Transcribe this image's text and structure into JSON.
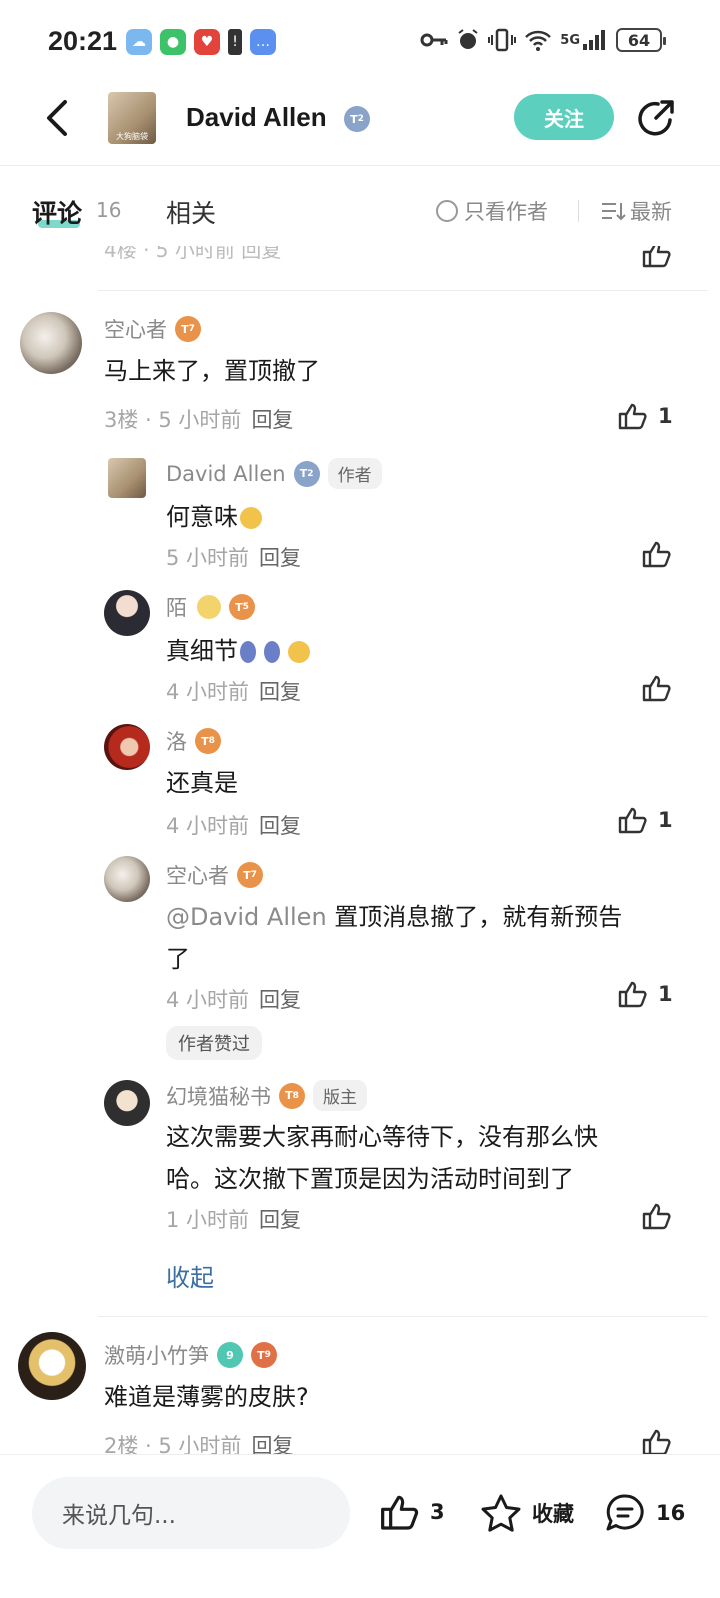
{
  "status_bar": {
    "time": "20:21",
    "network": "5G",
    "battery": "64",
    "icons": [
      "weather-icon",
      "wechat-icon",
      "heart-app-icon",
      "battery-saver-icon",
      "message-icon",
      "key-icon",
      "alarm-icon",
      "vibrate-icon",
      "wifi-icon",
      "signal-icon"
    ]
  },
  "header": {
    "avatar_caption": "大狗脑袋",
    "title": "David Allen",
    "level_badge": "2",
    "follow_label": "关注"
  },
  "tabs": {
    "comments_label": "评论",
    "comments_count": "16",
    "related_label": "相关",
    "only_author_label": "只看作者",
    "sort_label": "最新"
  },
  "partial_row": {
    "text": "4楼 · 5 小时前  回复"
  },
  "comments": [
    {
      "user": "空心者",
      "level": "7",
      "text": "马上来了，置顶撤了",
      "meta": "3楼 · 5 小时前",
      "reply": "回复",
      "likes": "1"
    },
    {
      "user": "David Allen",
      "level": "2",
      "tag": "作者",
      "text": "何意味",
      "meta": "5 小时前",
      "reply": "回复",
      "likes": ""
    },
    {
      "user": "陌",
      "level": "5",
      "text": "真细节",
      "meta": "4 小时前",
      "reply": "回复",
      "likes": ""
    },
    {
      "user": "洛",
      "level": "8",
      "text": "还真是",
      "meta": "4 小时前",
      "reply": "回复",
      "likes": "1"
    },
    {
      "user": "空心者",
      "level": "7",
      "mention": "@David Allen",
      "text_line1": " 置顶消息撤了，就有新预告",
      "text_line2": "了",
      "meta": "4 小时前",
      "reply": "回复",
      "likes": "1",
      "liked_by_author": "作者赞过"
    },
    {
      "user": "幻境猫秘书",
      "level": "8",
      "tag": "版主",
      "text_line1": "这次需要大家再耐心等待下，没有那么快",
      "text_line2": "哈。这次撤下置顶是因为活动时间到了",
      "meta": "1 小时前",
      "reply": "回复",
      "likes": ""
    },
    {
      "user": "激萌小竹笋",
      "level": "9",
      "level2": "9",
      "text": "难道是薄雾的皮肤?",
      "meta": "2楼 · 5 小时前",
      "reply": "回复",
      "likes": ""
    }
  ],
  "collapse_label": "收起",
  "bottom_bar": {
    "input_placeholder": "来说几句...",
    "likes": "3",
    "favorite_label": "收藏",
    "comments": "16"
  },
  "colors": {
    "accent": "#5ccfbf",
    "level_orange": "#e9934a",
    "level_blue": "#8aa3c8",
    "link_blue": "#3a6ea5"
  }
}
